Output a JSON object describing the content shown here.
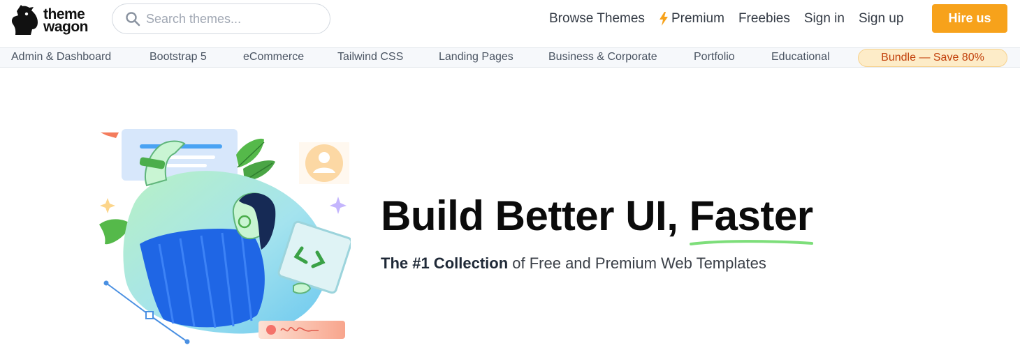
{
  "brand": {
    "line1": "theme",
    "line2": "wagon"
  },
  "search": {
    "placeholder": "Search themes..."
  },
  "topnav": {
    "browse": "Browse Themes",
    "premium": "Premium",
    "freebies": "Freebies",
    "signin": "Sign in",
    "signup": "Sign up",
    "hire": "Hire us"
  },
  "categories": {
    "admin": "Admin & Dashboard",
    "bootstrap": "Bootstrap 5",
    "ecommerce": "eCommerce",
    "tailwind": "Tailwind CSS",
    "landing": "Landing Pages",
    "business": "Business & Corporate",
    "portfolio": "Portfolio",
    "educational": "Educational",
    "bundle": "Bundle — Save 80%"
  },
  "hero": {
    "headline_start": "Build Better UI, ",
    "headline_accent": "Faster",
    "sub_bold": "The #1 Collection",
    "sub_rest": " of Free and Premium Web Templates"
  },
  "colors": {
    "accent_orange": "#f7a21b",
    "bundle_text": "#c2410c",
    "underline_green": "#7dde7a"
  },
  "icons": {
    "logo": "horse-head-icon",
    "search": "search-icon",
    "premium": "lightning-bolt-icon"
  }
}
